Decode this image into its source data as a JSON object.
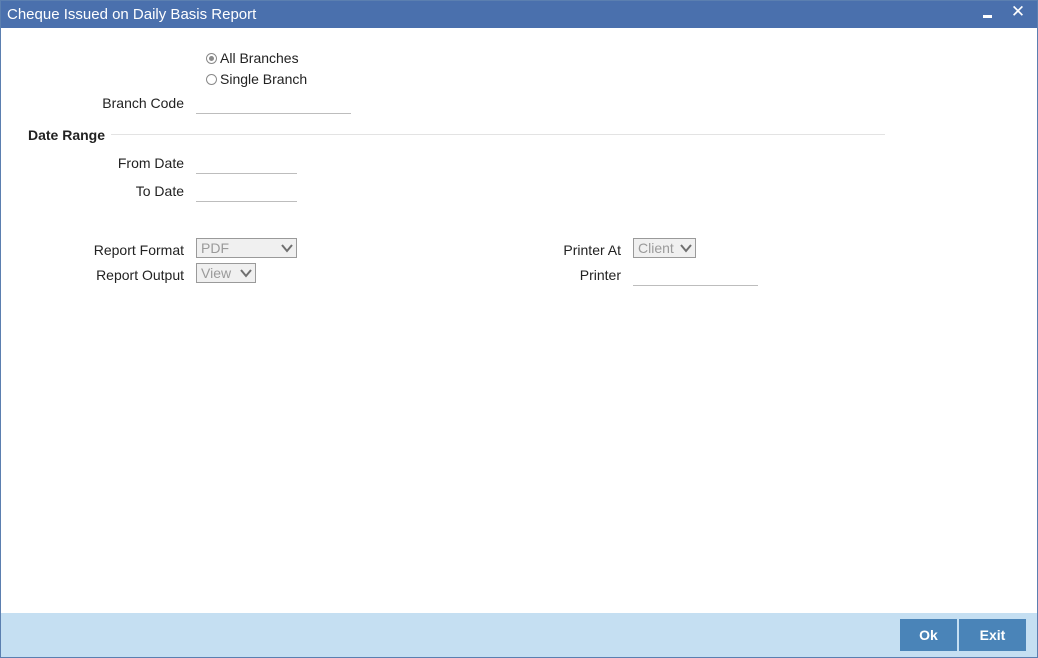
{
  "window": {
    "title": "Cheque Issued on Daily Basis Report"
  },
  "branch": {
    "options": [
      "All Branches",
      "Single Branch"
    ],
    "selected": "All Branches",
    "code_label": "Branch Code",
    "code_value": ""
  },
  "date_range": {
    "title": "Date Range",
    "from_label": "From Date",
    "from_value": "",
    "to_label": "To Date",
    "to_value": ""
  },
  "report": {
    "format_label": "Report Format",
    "format_value": "PDF",
    "output_label": "Report Output",
    "output_value": "View",
    "printer_at_label": "Printer At",
    "printer_at_value": "Client",
    "printer_label": "Printer",
    "printer_value": ""
  },
  "buttons": {
    "ok": "Ok",
    "exit": "Exit"
  },
  "icons": {
    "minimize": "minimize-icon",
    "close": "close-icon",
    "dropdown": "chevron-down-icon"
  }
}
